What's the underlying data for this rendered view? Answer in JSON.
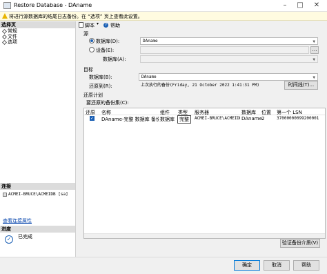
{
  "window": {
    "title": "Restore Database - DAname",
    "minimize_icon": "minimize-icon",
    "maximize_icon": "maximize-icon",
    "close_icon": "close-icon"
  },
  "warning": {
    "text": "将进行源数据库的结尾日志备份。在 “选项” 页上查看此设置。"
  },
  "left": {
    "select_page_header": "选择页",
    "pages": [
      "常规",
      "文件",
      "选项"
    ],
    "connection_header": "连接",
    "connection_value": "ACMEI-BRUCE\\ACMEIDB [sa]",
    "view_connection_link": "查看连接属性",
    "progress_header": "进度",
    "progress_status": "已完成"
  },
  "toolbar": {
    "script_label": "脚本",
    "help_label": "帮助"
  },
  "source": {
    "header": "源",
    "database_radio": "数据库(D):",
    "database_value": "DAname",
    "device_radio": "设备(E):",
    "device_database_label": "数据库(A):",
    "device_database_value": ""
  },
  "destination": {
    "header": "目标",
    "database_label": "数据库(B):",
    "database_value": "DAname",
    "restore_to_label": "还原到(R):",
    "restore_to_value": "上次执行的备份(Friday, 21 October 2022 1:41:31 PM)",
    "timeline_button": "时间线(T)..."
  },
  "restore_plan": {
    "header": "还原计划",
    "backup_sets_label": "要还原的备份集(C):",
    "columns": [
      "还原",
      "名称",
      "组件",
      "类型",
      "服务器",
      "数据库",
      "位置",
      "第一个 LSN"
    ],
    "rows": [
      {
        "restore": true,
        "name": "DAname-完整 数据库 备份",
        "component": "数据库",
        "type": "完整",
        "server": "ACMEI-BRUCE\\ACMEIDB",
        "database": "DAname",
        "position": "2",
        "first_lsn": "37000000099200001"
      }
    ],
    "verify_button": "验证备份介质(V)"
  },
  "footer": {
    "ok": "确定",
    "cancel": "取消",
    "help": "帮助"
  }
}
